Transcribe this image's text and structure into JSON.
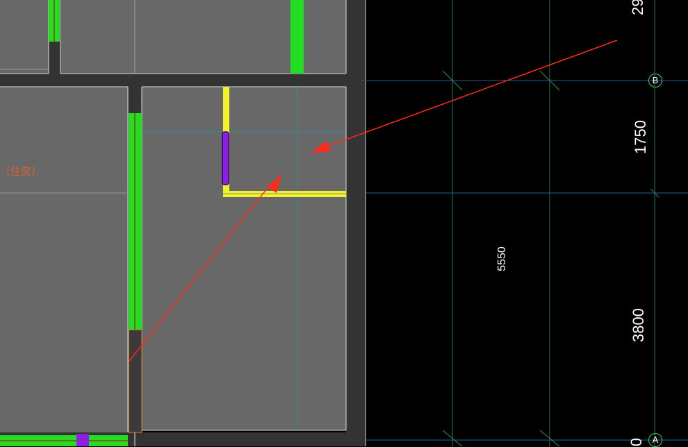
{
  "canvas": {
    "background": "#000000",
    "wall_fill": "#686868",
    "wall_edge": "#dcdcdc",
    "column_fill": "#333333",
    "accent_green": "#22dd22",
    "accent_yellow": "#f2f22a",
    "accent_purple": "#8b1fe6",
    "grid_line": "#2b8f8f",
    "arrow": "#ff2a1a"
  },
  "dimensions": {
    "top_partial": "29",
    "segment_b": "1750",
    "overall": "5550",
    "segment_a": "3800",
    "bottom_partial": "0"
  },
  "axes": {
    "b": "B",
    "a": "A"
  },
  "room_label": "（住房）"
}
